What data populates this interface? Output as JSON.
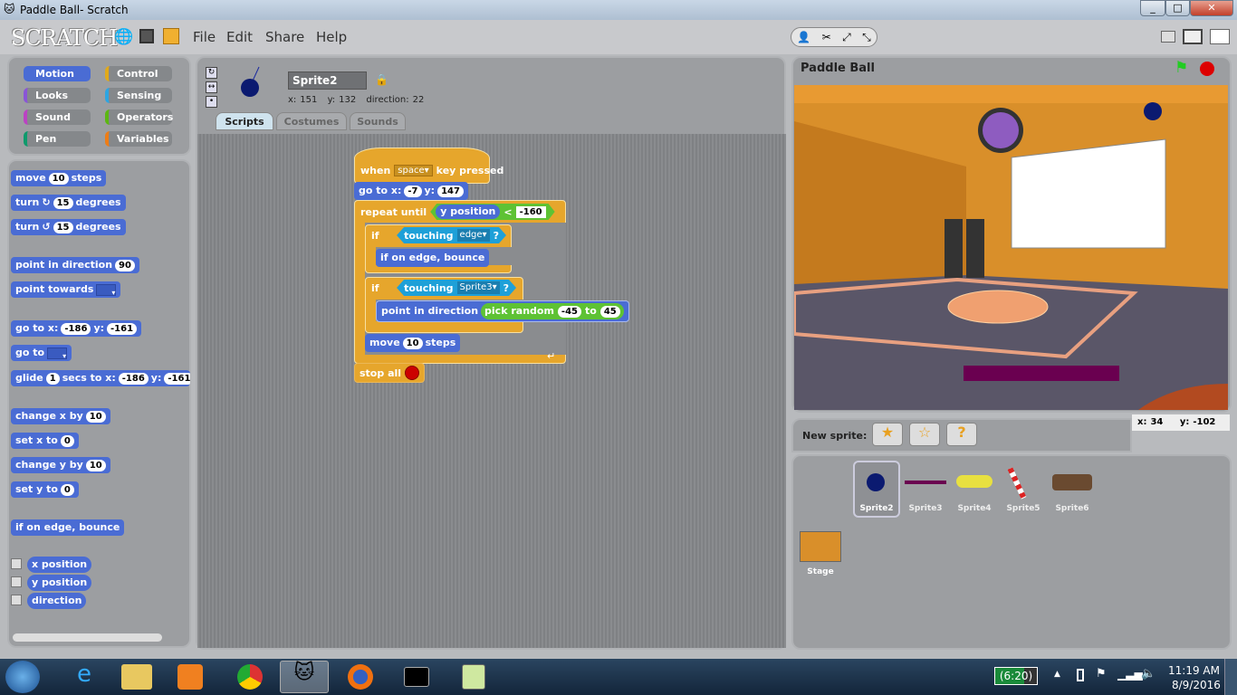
{
  "window": {
    "title": "Paddle Ball- Scratch",
    "min": "_",
    "max": "□",
    "close": "✕"
  },
  "menu": {
    "logo": "SCRATCH",
    "items": [
      "File",
      "Edit",
      "Share",
      "Help"
    ]
  },
  "categories": [
    {
      "label": "Motion",
      "color": "#4a6cd4"
    },
    {
      "label": "Control",
      "color": "#e1a91a"
    },
    {
      "label": "Looks",
      "color": "#8a55d7"
    },
    {
      "label": "Sensing",
      "color": "#2ca5e2"
    },
    {
      "label": "Sound",
      "color": "#bb42c3"
    },
    {
      "label": "Operators",
      "color": "#5cb712"
    },
    {
      "label": "Pen",
      "color": "#0e9a6c"
    },
    {
      "label": "Variables",
      "color": "#ee7d16"
    }
  ],
  "palette": {
    "move": [
      "move",
      "10",
      "steps"
    ],
    "turn_cw": [
      "turn",
      "15",
      "degrees"
    ],
    "turn_ccw": [
      "turn",
      "15",
      "degrees"
    ],
    "point_dir": [
      "point in direction",
      "90"
    ],
    "point_towards": "point towards",
    "goto_xy": [
      "go to x:",
      "-186",
      "y:",
      "-161"
    ],
    "goto": "go to",
    "glide": [
      "glide",
      "1",
      "secs to x:",
      "-186",
      "y:",
      "-161"
    ],
    "change_x": [
      "change x by",
      "10"
    ],
    "set_x": [
      "set x to",
      "0"
    ],
    "change_y": [
      "change y by",
      "10"
    ],
    "set_y": [
      "set y to",
      "0"
    ],
    "bounce": "if on edge, bounce",
    "xpos": "x position",
    "ypos": "y position",
    "direction": "direction"
  },
  "sprite": {
    "name": "Sprite2",
    "x_label": "x:",
    "x": "151",
    "y_label": "y:",
    "y": "132",
    "dir_label": "direction:",
    "dir": "22"
  },
  "tabs": [
    "Scripts",
    "Costumes",
    "Sounds"
  ],
  "script": {
    "hat": [
      "when",
      "space",
      "key pressed"
    ],
    "goto": [
      "go to x:",
      "-7",
      "y:",
      "147"
    ],
    "repeat": "repeat until",
    "ypos": "y position",
    "lt": "<",
    "limit": "-160",
    "if1": "if",
    "touching": "touching",
    "edge": "edge",
    "q": "?",
    "bounce": "if on edge, bounce",
    "if2": "if",
    "sprite3": "Sprite3",
    "point": "point in direction",
    "pick": "pick random",
    "from": "-45",
    "to": "to",
    "toval": "45",
    "move": [
      "move",
      "10",
      "steps"
    ],
    "stop": "stop all"
  },
  "stage": {
    "title": "Paddle Ball",
    "mouse_x_label": "x:",
    "mouse_x": "34",
    "mouse_y_label": "y:",
    "mouse_y": "-102"
  },
  "sprites": {
    "new_label": "New sprite:",
    "list": [
      "Sprite2",
      "Sprite3",
      "Sprite4",
      "Sprite5",
      "Sprite6"
    ],
    "stage_label": "Stage"
  },
  "tray": {
    "battery": "(6:20)",
    "time": "11:19 AM",
    "date": "8/9/2016"
  }
}
